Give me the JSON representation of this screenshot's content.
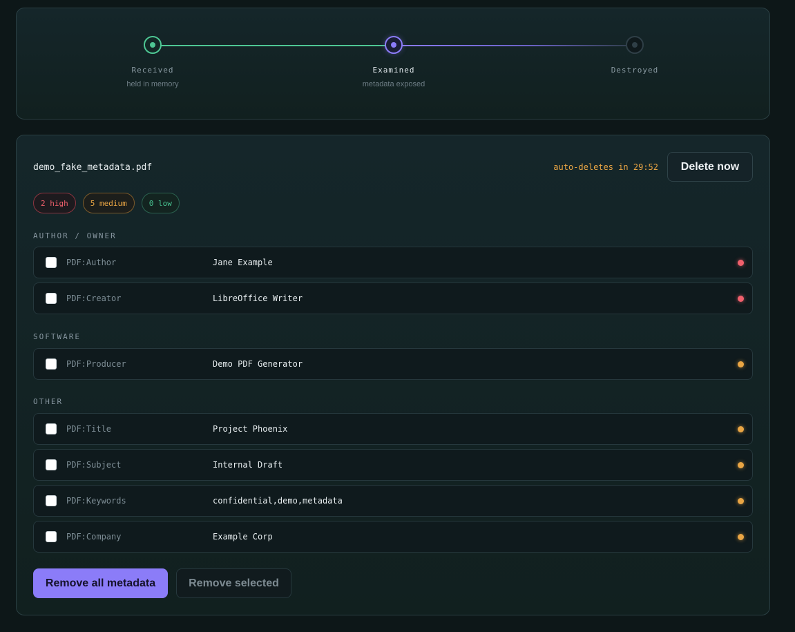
{
  "stepper": {
    "steps": [
      {
        "title": "Received",
        "subtitle": "held in memory",
        "state": "done"
      },
      {
        "title": "Examined",
        "subtitle": "metadata exposed",
        "state": "active"
      },
      {
        "title": "Destroyed",
        "subtitle": "",
        "state": "pending"
      }
    ]
  },
  "file": {
    "name": "demo_fake_metadata.pdf",
    "countdown": "auto-deletes in 29:52",
    "delete_label": "Delete now"
  },
  "badges": {
    "high": "2 high",
    "medium": "5 medium",
    "low": "0 low"
  },
  "sections": [
    {
      "title": "AUTHOR / OWNER",
      "rows": [
        {
          "key": "PDF:Author",
          "value": "Jane Example",
          "severity": "high",
          "checked": false
        },
        {
          "key": "PDF:Creator",
          "value": "LibreOffice Writer",
          "severity": "high",
          "checked": false
        }
      ]
    },
    {
      "title": "SOFTWARE",
      "rows": [
        {
          "key": "PDF:Producer",
          "value": "Demo PDF Generator",
          "severity": "medium",
          "checked": false
        }
      ]
    },
    {
      "title": "OTHER",
      "rows": [
        {
          "key": "PDF:Title",
          "value": "Project Phoenix",
          "severity": "medium",
          "checked": false
        },
        {
          "key": "PDF:Subject",
          "value": "Internal Draft",
          "severity": "medium",
          "checked": false
        },
        {
          "key": "PDF:Keywords",
          "value": "confidential,demo,metadata",
          "severity": "medium",
          "checked": false
        },
        {
          "key": "PDF:Company",
          "value": "Example Corp",
          "severity": "medium",
          "checked": false
        }
      ]
    }
  ],
  "actions": {
    "remove_all_label": "Remove all metadata",
    "remove_selected_label": "Remove selected"
  },
  "colors": {
    "accent": "#8b7cf8",
    "success": "#4ec794",
    "high": "#f0606c",
    "medium": "#e9a544",
    "background": "#0d1718"
  }
}
